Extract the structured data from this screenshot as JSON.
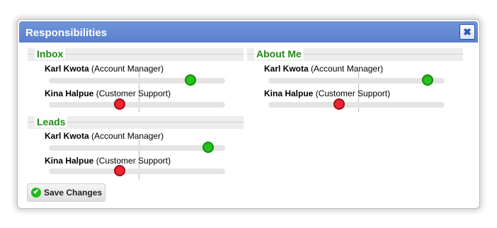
{
  "dialog": {
    "title": "Responsibilities",
    "close_icon": "close-icon",
    "save_label": "Save Changes",
    "save_icon": "check-circle-icon"
  },
  "sections": [
    {
      "title": "Inbox",
      "people": [
        {
          "name": "Karl Kwota",
          "role": "(Account Manager)",
          "level": 0.8,
          "status": "green"
        },
        {
          "name": "Kina Halpue",
          "role": "(Customer Support)",
          "level": 0.4,
          "status": "red"
        }
      ]
    },
    {
      "title": "Leads",
      "people": [
        {
          "name": "Karl Kwota",
          "role": "(Account Manager)",
          "level": 0.9,
          "status": "green"
        },
        {
          "name": "Kina Halpue",
          "role": "(Customer Support)",
          "level": 0.4,
          "status": "red"
        }
      ]
    },
    {
      "title": "About Me",
      "people": [
        {
          "name": "Karl Kwota",
          "role": "(Account Manager)",
          "level": 0.9,
          "status": "green"
        },
        {
          "name": "Kina Halpue",
          "role": "(Customer Support)",
          "level": 0.4,
          "status": "red"
        }
      ]
    }
  ],
  "colors": {
    "titlebar": "#5f85d2",
    "section_title": "#1f8a14",
    "green_knob": "#25c21b",
    "red_knob": "#ee2430"
  }
}
